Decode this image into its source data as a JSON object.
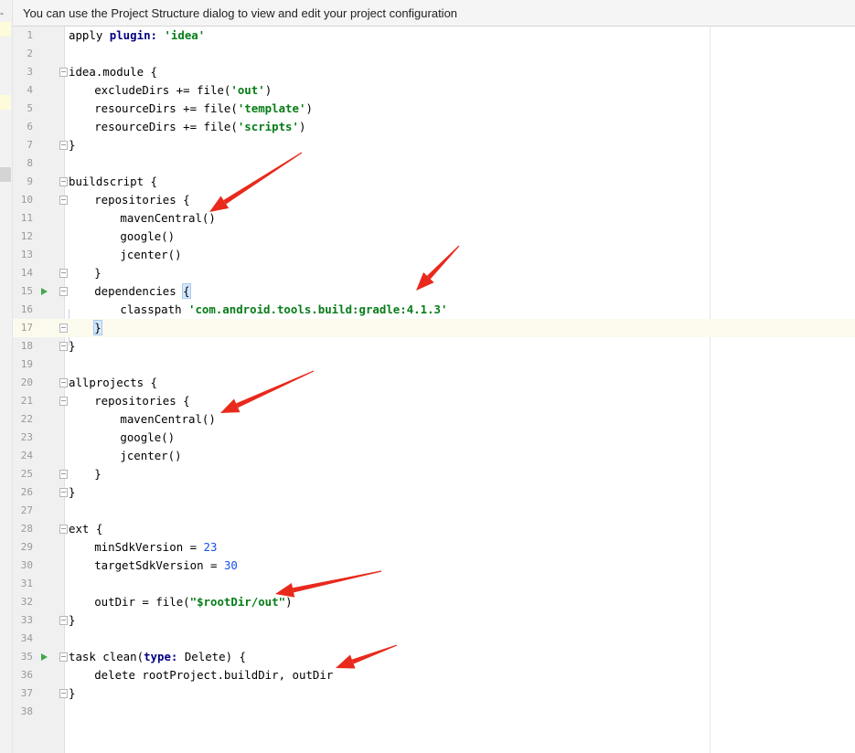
{
  "left_strip": {
    "tab_label": "-m"
  },
  "banner": {
    "text": "You can use the Project Structure dialog to view and edit your project configuration"
  },
  "editor": {
    "current_line": 17,
    "lines": [
      {
        "n": "1",
        "indent": 0,
        "tokens": [
          {
            "t": "apply "
          },
          {
            "t": "plugin:",
            "c": "kw"
          },
          {
            "t": " "
          },
          {
            "t": "'idea'",
            "c": "str"
          }
        ]
      },
      {
        "n": "2",
        "indent": 0,
        "tokens": []
      },
      {
        "n": "3",
        "indent": 0,
        "fold": true,
        "tokens": [
          {
            "t": "idea.module {"
          }
        ]
      },
      {
        "n": "4",
        "indent": 4,
        "tokens": [
          {
            "t": "excludeDirs += file("
          },
          {
            "t": "'out'",
            "c": "str"
          },
          {
            "t": ")"
          }
        ]
      },
      {
        "n": "5",
        "indent": 4,
        "tokens": [
          {
            "t": "resourceDirs += file("
          },
          {
            "t": "'template'",
            "c": "str"
          },
          {
            "t": ")"
          }
        ]
      },
      {
        "n": "6",
        "indent": 4,
        "tokens": [
          {
            "t": "resourceDirs += file("
          },
          {
            "t": "'scripts'",
            "c": "str"
          },
          {
            "t": ")"
          }
        ]
      },
      {
        "n": "7",
        "indent": 0,
        "fold": true,
        "tokens": [
          {
            "t": "}"
          }
        ]
      },
      {
        "n": "8",
        "indent": 0,
        "tokens": []
      },
      {
        "n": "9",
        "indent": 0,
        "fold": true,
        "tokens": [
          {
            "t": "buildscript {"
          }
        ]
      },
      {
        "n": "10",
        "indent": 4,
        "fold": true,
        "tokens": [
          {
            "t": "repositories {"
          }
        ]
      },
      {
        "n": "11",
        "indent": 8,
        "tokens": [
          {
            "t": "mavenCentral()"
          }
        ]
      },
      {
        "n": "12",
        "indent": 8,
        "tokens": [
          {
            "t": "google()"
          }
        ]
      },
      {
        "n": "13",
        "indent": 8,
        "tokens": [
          {
            "t": "jcenter()"
          }
        ]
      },
      {
        "n": "14",
        "indent": 4,
        "fold": true,
        "tokens": [
          {
            "t": "}"
          }
        ]
      },
      {
        "n": "15",
        "indent": 4,
        "run": true,
        "fold": true,
        "tokens": [
          {
            "t": "dependencies "
          },
          {
            "t": "{",
            "c": "brace-hl"
          }
        ]
      },
      {
        "n": "16",
        "indent": 8,
        "tokens": [
          {
            "t": "classpath "
          },
          {
            "t": "'com.android.tools.build:gradle:4.1.3'",
            "c": "str"
          }
        ]
      },
      {
        "n": "17",
        "indent": 4,
        "fold": true,
        "tokens": [
          {
            "t": "}",
            "c": "brace-hl"
          },
          {
            "caret": true
          }
        ]
      },
      {
        "n": "18",
        "indent": 0,
        "fold": true,
        "tokens": [
          {
            "t": "}"
          }
        ]
      },
      {
        "n": "19",
        "indent": 0,
        "tokens": []
      },
      {
        "n": "20",
        "indent": 0,
        "fold": true,
        "tokens": [
          {
            "t": "allprojects {"
          }
        ]
      },
      {
        "n": "21",
        "indent": 4,
        "fold": true,
        "tokens": [
          {
            "t": "repositories {"
          }
        ]
      },
      {
        "n": "22",
        "indent": 8,
        "tokens": [
          {
            "t": "mavenCentral()"
          }
        ]
      },
      {
        "n": "23",
        "indent": 8,
        "tokens": [
          {
            "t": "google()"
          }
        ]
      },
      {
        "n": "24",
        "indent": 8,
        "tokens": [
          {
            "t": "jcenter()"
          }
        ]
      },
      {
        "n": "25",
        "indent": 4,
        "fold": true,
        "tokens": [
          {
            "t": "}"
          }
        ]
      },
      {
        "n": "26",
        "indent": 0,
        "fold": true,
        "tokens": [
          {
            "t": "}"
          }
        ]
      },
      {
        "n": "27",
        "indent": 0,
        "tokens": []
      },
      {
        "n": "28",
        "indent": 0,
        "fold": true,
        "tokens": [
          {
            "t": "ext {"
          }
        ]
      },
      {
        "n": "29",
        "indent": 4,
        "tokens": [
          {
            "t": "minSdkVersion = "
          },
          {
            "t": "23",
            "c": "num"
          }
        ]
      },
      {
        "n": "30",
        "indent": 4,
        "tokens": [
          {
            "t": "targetSdkVersion = "
          },
          {
            "t": "30",
            "c": "num"
          }
        ]
      },
      {
        "n": "31",
        "indent": 0,
        "tokens": []
      },
      {
        "n": "32",
        "indent": 4,
        "tokens": [
          {
            "t": "outDir = file("
          },
          {
            "t": "\"$rootDir",
            "c": "str"
          },
          {
            "t": "/out",
            "c": "ivar"
          },
          {
            "t": "\"",
            "c": "str"
          },
          {
            "t": ")"
          }
        ]
      },
      {
        "n": "33",
        "indent": 0,
        "fold": true,
        "tokens": [
          {
            "t": "}"
          }
        ]
      },
      {
        "n": "34",
        "indent": 0,
        "tokens": []
      },
      {
        "n": "35",
        "indent": 0,
        "run": true,
        "fold": true,
        "tokens": [
          {
            "t": "task clean("
          },
          {
            "t": "type:",
            "c": "kw"
          },
          {
            "t": " Delete) {"
          }
        ]
      },
      {
        "n": "36",
        "indent": 4,
        "tokens": [
          {
            "t": "delete rootProject.buildDir, outDir"
          }
        ]
      },
      {
        "n": "37",
        "indent": 0,
        "fold": true,
        "tokens": [
          {
            "t": "}"
          }
        ]
      },
      {
        "n": "38",
        "indent": 0,
        "tokens": []
      }
    ]
  },
  "annotation_color": "#e8291c"
}
